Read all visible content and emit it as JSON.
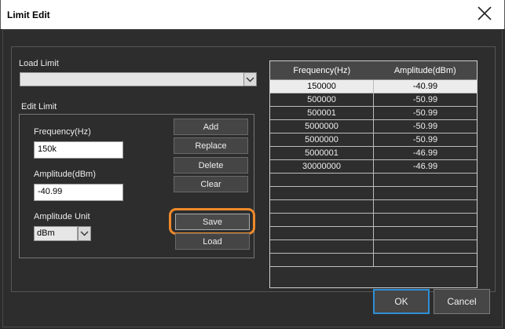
{
  "window": {
    "title": "Limit Edit"
  },
  "load_limit": {
    "label": "Load Limit",
    "value": ""
  },
  "edit_limit": {
    "label": "Edit Limit",
    "frequency_label": "Frequency(Hz)",
    "frequency_value": "150k",
    "amplitude_label": "Amplitude(dBm)",
    "amplitude_value": "-40.99",
    "unit_label": "Amplitude Unit",
    "unit_value": "dBm"
  },
  "buttons": {
    "add": "Add",
    "replace": "Replace",
    "delete": "Delete",
    "clear": "Clear",
    "save": "Save",
    "load": "Load"
  },
  "table": {
    "headers": [
      "Frequency(Hz)",
      "Amplitude(dBm)"
    ],
    "rows": [
      [
        "150000",
        "-40.99"
      ],
      [
        "500000",
        "-50.99"
      ],
      [
        "500001",
        "-50.99"
      ],
      [
        "5000000",
        "-50.99"
      ],
      [
        "5000000",
        "-50.99"
      ],
      [
        "5000001",
        "-46.99"
      ],
      [
        "30000000",
        "-46.99"
      ],
      [
        "",
        ""
      ],
      [
        "",
        ""
      ],
      [
        "",
        ""
      ],
      [
        "",
        ""
      ],
      [
        "",
        ""
      ],
      [
        "",
        ""
      ],
      [
        "",
        ""
      ]
    ],
    "selected_row": 0
  },
  "footer": {
    "ok": "OK",
    "cancel": "Cancel"
  },
  "colors": {
    "accent": "#2f8fd6",
    "highlight": "#f08a2a"
  }
}
